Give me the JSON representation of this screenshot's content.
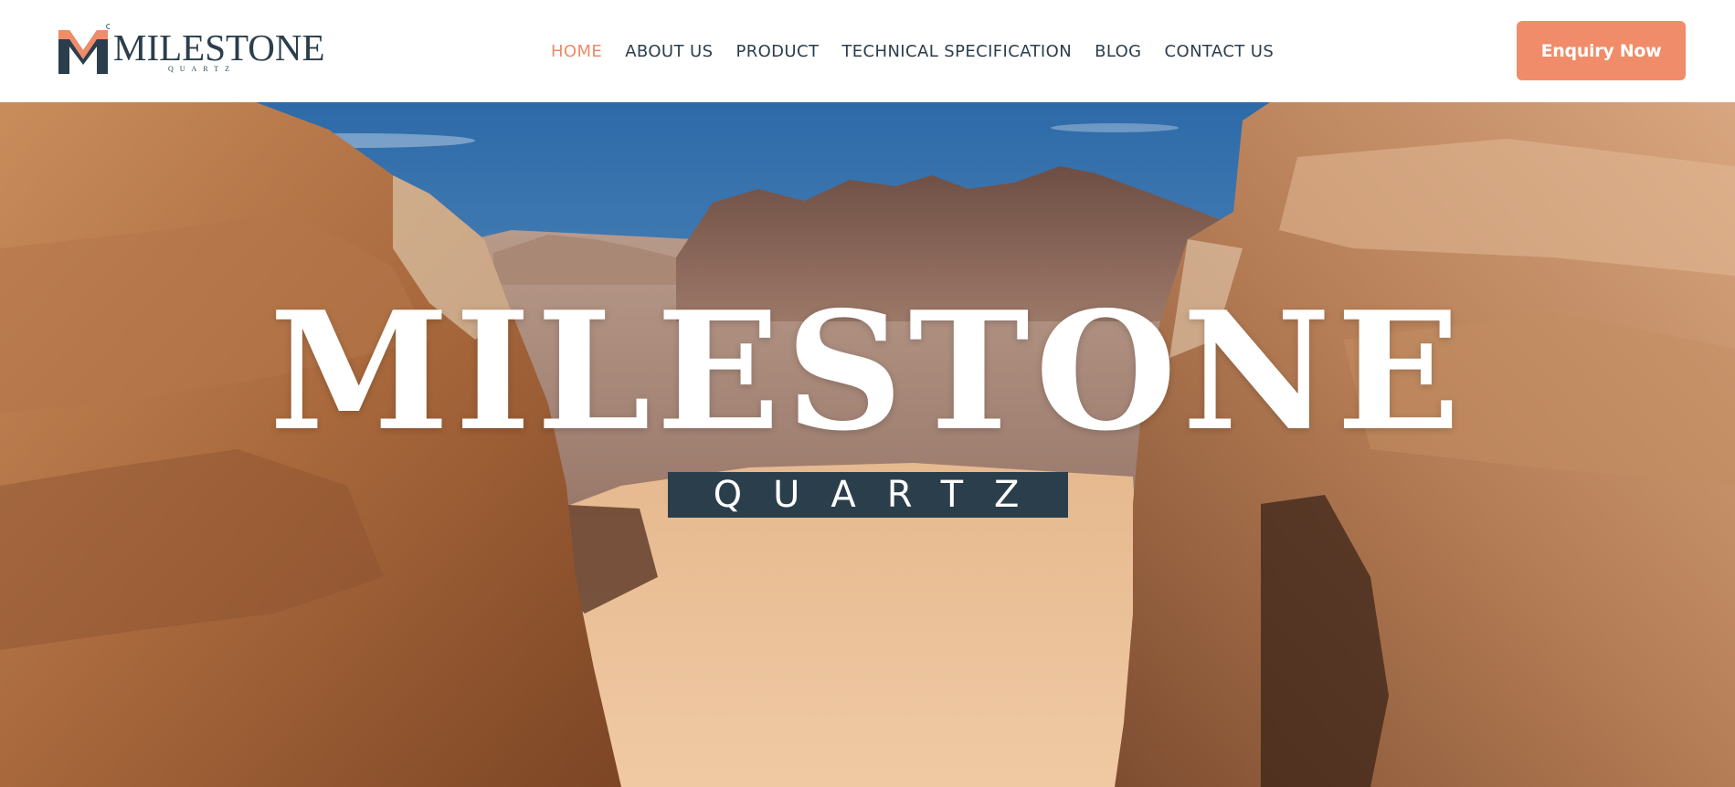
{
  "brand": {
    "name": "MILESTONE",
    "tagline": "QUARTZ",
    "accent": "#f08c69",
    "navy": "#2b3e4c"
  },
  "nav": {
    "items": [
      {
        "label": "HOME",
        "active": true
      },
      {
        "label": "ABOUT US",
        "active": false
      },
      {
        "label": "PRODUCT",
        "active": false
      },
      {
        "label": "TECHNICAL SPECIFICATION",
        "active": false
      },
      {
        "label": "BLOG",
        "active": false
      },
      {
        "label": "CONTACT US",
        "active": false
      }
    ]
  },
  "cta": {
    "label": "Enquiry Now"
  },
  "hero": {
    "title": "MILESTONE",
    "subtitle": "QUARTZ",
    "background": "desert-canyon-rocks-image"
  }
}
